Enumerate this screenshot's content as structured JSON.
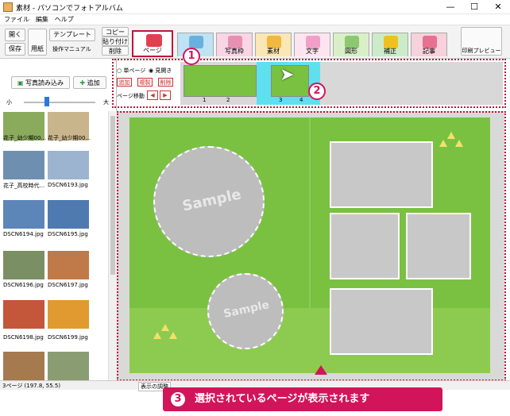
{
  "window": {
    "title": "素材 - パソコンでフォトアルバム",
    "min": "—",
    "max": "☐",
    "close": "✕"
  },
  "menu": [
    "ファイル",
    "編集",
    "ヘルプ"
  ],
  "toolbar": {
    "open": "開く",
    "save": "保存",
    "paper": "用紙",
    "template": "テンプレート",
    "manual": "操作マニュアル",
    "copy": "コピー",
    "paste": "貼り付け",
    "delete": "削除",
    "print_preview": "印刷プレビュー"
  },
  "tabs": [
    {
      "label": "ページ",
      "color": "#ffffff"
    },
    {
      "label": "",
      "color": "#bfe2f5"
    },
    {
      "label": "写真枠",
      "color": "#f9d5e5"
    },
    {
      "label": "素材",
      "color": "#fbe6b5"
    },
    {
      "label": "文字",
      "color": "#fde4f0"
    },
    {
      "label": "図形",
      "color": "#d9f0c7"
    },
    {
      "label": "補正",
      "color": "#ccebc9"
    },
    {
      "label": "記事",
      "color": "#f7d1dc"
    }
  ],
  "left": {
    "load_photos": "写真読み込み",
    "add": "追加",
    "size_small": "小",
    "size_large": "大"
  },
  "thumbs": [
    {
      "name": "花子_幼少期00...",
      "color": "#8aab5c"
    },
    {
      "name": "花子_幼少期00...",
      "color": "#c9b58c"
    },
    {
      "name": "花子_高校時代...",
      "color": "#6f8fb0"
    },
    {
      "name": "DSCN6193.jpg",
      "color": "#9cb4cf"
    },
    {
      "name": "DSCN6194.jpg",
      "color": "#5d86b8"
    },
    {
      "name": "DSCN6195.jpg",
      "color": "#4f7ab0"
    },
    {
      "name": "DSCN6196.jpg",
      "color": "#7a8f63"
    },
    {
      "name": "DSCN6197.jpg",
      "color": "#c07a4a"
    },
    {
      "name": "DSCN6198.jpg",
      "color": "#c4563a"
    },
    {
      "name": "DSCN6199.jpg",
      "color": "#e09a30"
    },
    {
      "name": "",
      "color": "#a57a4f"
    },
    {
      "name": "",
      "color": "#8a9d72"
    }
  ],
  "pagepanel": {
    "single": "単ページ",
    "spread": "見開き",
    "add": "追加",
    "duplicate": "複製",
    "remove": "削除",
    "move_label": "ページ移動",
    "move_left": "◀",
    "move_right": "▶",
    "pages": [
      "1",
      "2",
      "3",
      "4"
    ]
  },
  "callouts": {
    "one": "1",
    "two": "2",
    "three": "3"
  },
  "banner": "選択されているページが表示されます",
  "watermark": "Sample",
  "status": {
    "left": "3ページ (197.8, 55.5)",
    "center": "表示の調整"
  }
}
